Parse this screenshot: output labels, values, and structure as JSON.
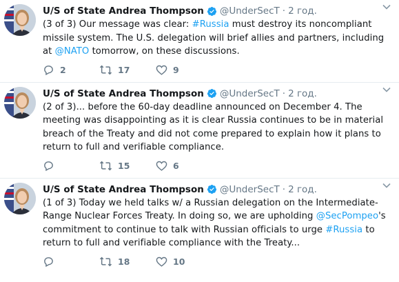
{
  "tweets": [
    {
      "author": "U/S of State Andrea Thompson",
      "handle": "@UnderSecT",
      "time": "2 год.",
      "text_parts": [
        {
          "t": "(3 of 3) Our message was clear:  "
        },
        {
          "t": "#Russia",
          "link": true
        },
        {
          "t": " must destroy its noncompliant missile system. The U.S. delegation will brief allies and partners, including at "
        },
        {
          "t": "@NATO",
          "link": true
        },
        {
          "t": " tomorrow, on these discussions."
        }
      ],
      "replies": "2",
      "retweets": "17",
      "likes": "9"
    },
    {
      "author": "U/S of State Andrea Thompson",
      "handle": "@UnderSecT",
      "time": "2 год.",
      "text_parts": [
        {
          "t": "(2 of 3)... before the 60-day deadline announced on December 4.  The meeting was disappointing as it is clear Russia continues to be in material breach of the Treaty and did not come prepared to explain how it plans to return to full and verifiable compliance."
        }
      ],
      "replies": "",
      "retweets": "15",
      "likes": "6"
    },
    {
      "author": "U/S of State Andrea Thompson",
      "handle": "@UnderSecT",
      "time": "2 год.",
      "text_parts": [
        {
          "t": "(1 of 3) Today we held talks w/ a Russian delegation on the Intermediate-Range Nuclear Forces Treaty.  In doing so, we are upholding "
        },
        {
          "t": "@SecPompeo",
          "link": true
        },
        {
          "t": "'s commitment to continue to talk with Russian officials to urge "
        },
        {
          "t": "#Russia",
          "link": true
        },
        {
          "t": " to return to full and verifiable compliance with the Treaty..."
        }
      ],
      "replies": "",
      "retweets": "18",
      "likes": "10"
    }
  ],
  "colors": {
    "link": "#1da1f2",
    "verified": "#1da1f2",
    "muted": "#657786",
    "divider": "#e6ecf0"
  },
  "icons": [
    "verified-badge-icon",
    "chevron-down-icon",
    "reply-icon",
    "retweet-icon",
    "like-icon"
  ]
}
